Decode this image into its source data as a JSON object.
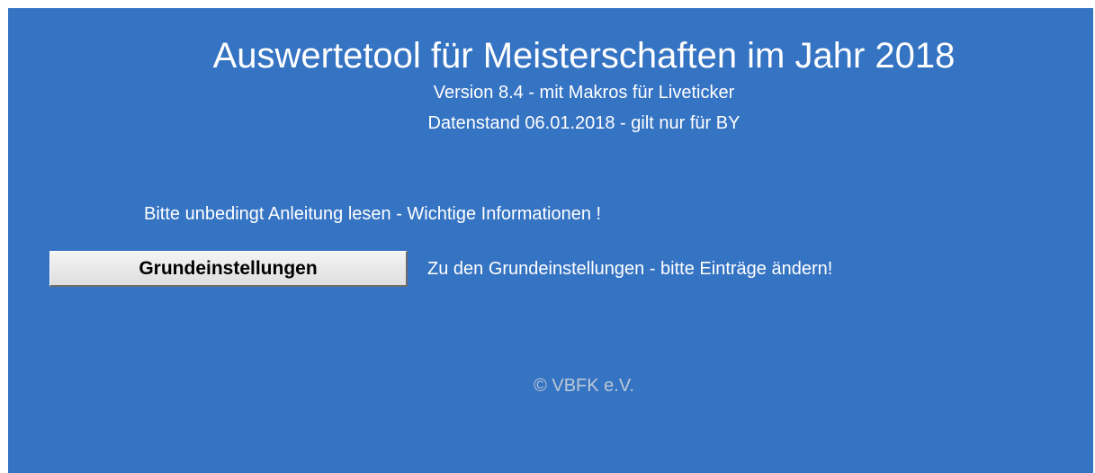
{
  "header": {
    "title": "Auswertetool für Meisterschaften im Jahr 2018",
    "version_line": "Version 8.4 - mit Makros für Liveticker",
    "data_line": "Datenstand 06.01.2018 - gilt nur für BY"
  },
  "main": {
    "notice": "Bitte unbedingt Anleitung lesen - Wichtige Informationen !",
    "settings_button_label": "Grundeinstellungen",
    "settings_hint": "Zu den Grundeinstellungen - bitte Einträge ändern!"
  },
  "footer": {
    "copyright": "© VBFK e.V."
  },
  "colors": {
    "background": "#3573c3",
    "text": "#ffffff",
    "copyright_text": "#bcc8d6",
    "button_face": "#e8e8e8"
  }
}
